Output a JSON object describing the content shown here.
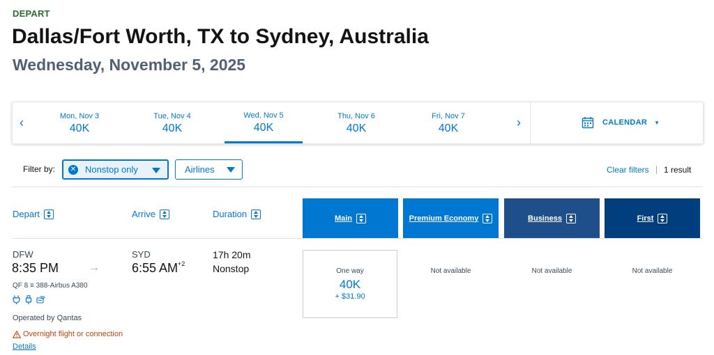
{
  "header": {
    "kicker": "DEPART",
    "title": "Dallas/Fort Worth, TX to Sydney, Australia",
    "date": "Wednesday, November 5, 2025"
  },
  "date_strip": {
    "prev_icon": "chevron-left-icon",
    "next_icon": "chevron-right-icon",
    "prev_glyph": "‹",
    "next_glyph": "›",
    "days": [
      {
        "label": "Mon, Nov 3",
        "price": "40K",
        "selected": false
      },
      {
        "label": "Tue, Nov 4",
        "price": "40K",
        "selected": false
      },
      {
        "label": "Wed, Nov 5",
        "price": "40K",
        "selected": true
      },
      {
        "label": "Thu, Nov 6",
        "price": "40K",
        "selected": false
      },
      {
        "label": "Fri, Nov 7",
        "price": "40K",
        "selected": false
      }
    ],
    "calendar_label": "CALENDAR",
    "calendar_icon": "calendar-icon"
  },
  "filters": {
    "label": "Filter by:",
    "nonstop": "Nonstop only",
    "airlines": "Airlines",
    "clear": "Clear filters",
    "separator": "|",
    "result_count": "1 result"
  },
  "columns": {
    "depart": "Depart",
    "arrive": "Arrive",
    "duration": "Duration",
    "cabins": [
      "Main",
      "Premium Economy",
      "Business",
      "First"
    ]
  },
  "flight": {
    "depart_code": "DFW",
    "depart_time": "8:35 PM",
    "arrive_code": "SYD",
    "arrive_time": "6:55 AM",
    "day_offset": "+2",
    "duration": "17h 20m",
    "stops": "Nonstop",
    "flight_info": "QF 8 ≡ 388-Airbus A380",
    "amenities": [
      "power-plug-icon",
      "usb-icon",
      "wifi-icon"
    ],
    "operated_by": "Operated by Qantas",
    "overnight": "Overnight flight or connection",
    "details": "Details",
    "fares": {
      "main": {
        "label": "One way",
        "miles": "40K",
        "tax": "+ $31.90"
      },
      "premium_economy": "Not available",
      "business": "Not available",
      "first": "Not available"
    }
  },
  "colors": {
    "accent": "#0078d2",
    "business_header": "#1f4f8a",
    "first_header": "#003e7e",
    "kicker": "#2f6b2f",
    "warning": "#c3420b"
  }
}
